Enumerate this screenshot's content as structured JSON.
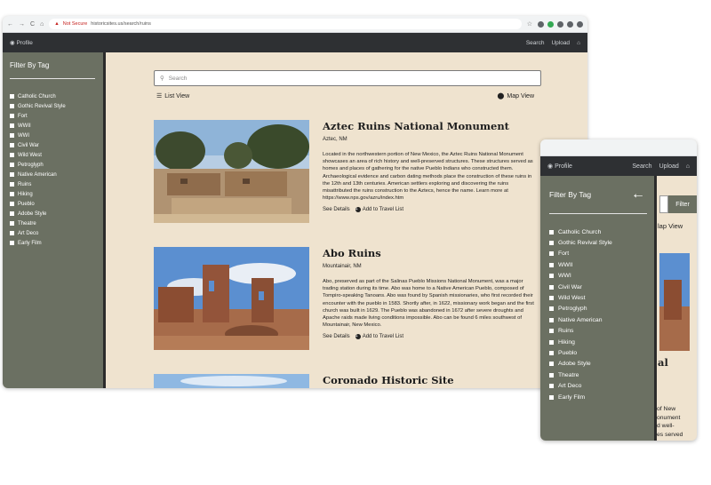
{
  "browser": {
    "security_label": "Not Secure",
    "url": "historicsites.us/search/ruins"
  },
  "nav": {
    "profile_label": "Profile",
    "search_label": "Search",
    "upload_label": "Upload"
  },
  "sidebar": {
    "title": "Filter By Tag",
    "tags": [
      "Catholic Church",
      "Gothic Revival Style",
      "Fort",
      "WWII",
      "WWI",
      "Civil War",
      "Wild West",
      "Petroglyph",
      "Native American",
      "Ruins",
      "Hiking",
      "Pueblo",
      "Adobe Style",
      "Theatre",
      "Art Deco",
      "Early Film"
    ]
  },
  "search": {
    "placeholder": "Search"
  },
  "views": {
    "list_label": "List View",
    "map_label": "Map View"
  },
  "results": [
    {
      "title": "Aztec Ruins National Monument",
      "location": "Aztec, NM",
      "description": "Located in the northwestern portion of New Mexico, the Aztec Ruins National Monument showcases an area of rich history and well-preserved structures. These structures served as homes and places of gathering for the native Pueblo Indians who constructed them. Archaeological evidence and carbon dating methods place the construction of these ruins in the 12th and 13th centuries. American settlers exploring and discovering the ruins misattributed the ruins construction to the Aztecs, hence the name. Learn more at https://www.nps.gov/azru/index.htm",
      "details_label": "See Details",
      "travel_label": "Add to Travel List"
    },
    {
      "title": "Abo Ruins",
      "location": "Mountainair, NM",
      "description": "Abo, preserved as part of the Salinas Pueblo Missions National Monument, was a major trading station during its time. Abo was home to a Native American Pueblo, composed of Tompiro-speaking Tanoans. Abo was found by Spanish missionaries, who first recorded their encounter with the pueblo in 1583. Shortly after, in 1622, missionary work began and the first church was built in 1629. The Pueblo was abandoned in 1672 after severe droughts and Apache raids made living conditions impossible. Abo can be found 6 miles southwest of Mountainair, New Mexico.",
      "details_label": "See Details",
      "travel_label": "Add to Travel List"
    },
    {
      "title": "Coronado Historic Site"
    }
  ],
  "mobile": {
    "filter_button": "Filter",
    "map_view_partial": "lap View",
    "title_partial": "al",
    "desc_lines": [
      "of New",
      "onument",
      "d well-",
      "es served"
    ]
  },
  "colors": {
    "sidebar_bg": "#6b7062",
    "nav_bg": "#2e3033",
    "page_bg": "#efe3cf"
  }
}
